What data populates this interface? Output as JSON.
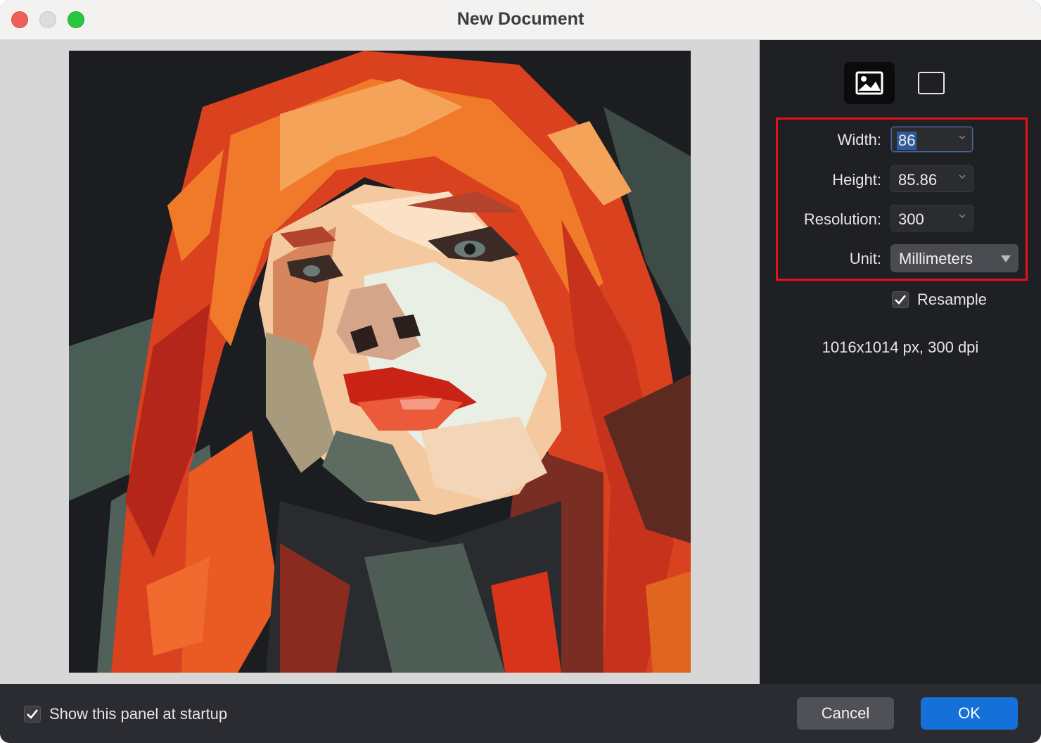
{
  "window": {
    "title": "New Document"
  },
  "sidebar": {
    "mode_buttons": [
      {
        "name": "image-mode",
        "icon": "image-icon",
        "selected": true
      },
      {
        "name": "blank-mode",
        "icon": "blank-canvas-icon",
        "selected": false
      }
    ],
    "fields": {
      "width": {
        "label": "Width:",
        "value": "86"
      },
      "height": {
        "label": "Height:",
        "value": "85.86"
      },
      "resolution": {
        "label": "Resolution:",
        "value": "300"
      },
      "unit": {
        "label": "Unit:",
        "value": "Millimeters"
      }
    },
    "resample": {
      "label": "Resample",
      "checked": true
    },
    "size_info": "1016x1014 px, 300 dpi",
    "highlight_color": "#e8101b"
  },
  "footer": {
    "show_at_startup": {
      "label": "Show this panel at startup",
      "checked": true
    },
    "cancel_label": "Cancel",
    "ok_label": "OK"
  },
  "colors": {
    "accent": "#1571d9",
    "sidebar_bg": "#1f2024",
    "preview_bg": "#d7d7d7"
  }
}
